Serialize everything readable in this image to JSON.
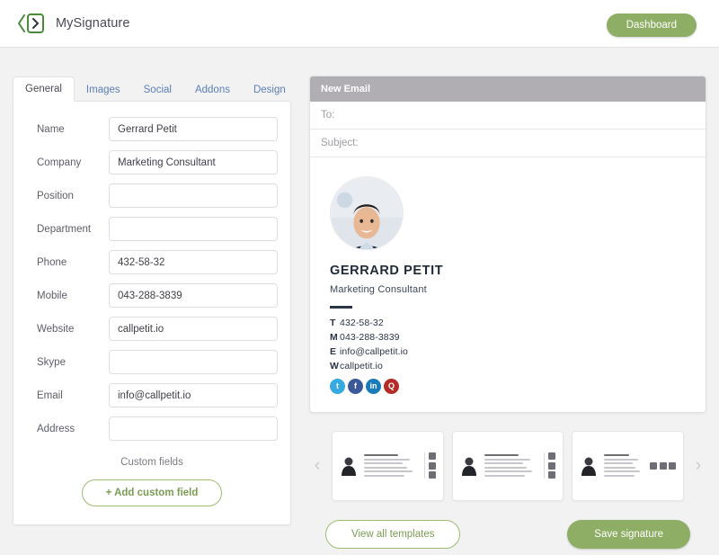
{
  "header": {
    "brand_name": "MySignature",
    "logo_icon": "code-brackets-logo-icon",
    "dashboard_label": "Dashboard"
  },
  "colors": {
    "brand_green": "#8fae65",
    "green_outline": "#9cbd71",
    "tab_link": "#5b7fb5",
    "email_header_bar": "#b0aeb3",
    "page_background": "#f2f2f3"
  },
  "tabs": [
    {
      "label": "General",
      "active": true
    },
    {
      "label": "Images",
      "active": false
    },
    {
      "label": "Social",
      "active": false
    },
    {
      "label": "Addons",
      "active": false
    },
    {
      "label": "Design",
      "active": false
    }
  ],
  "form": {
    "fields": [
      {
        "label": "Name",
        "value": "Gerrard Petit",
        "placeholder": ""
      },
      {
        "label": "Company",
        "value": "Marketing Consultant",
        "placeholder": ""
      },
      {
        "label": "Position",
        "value": "",
        "placeholder": ""
      },
      {
        "label": "Department",
        "value": "",
        "placeholder": ""
      },
      {
        "label": "Phone",
        "value": "432-58-32",
        "placeholder": ""
      },
      {
        "label": "Mobile",
        "value": "043-288-3839",
        "placeholder": ""
      },
      {
        "label": "Website",
        "value": "callpetit.io",
        "placeholder": ""
      },
      {
        "label": "Skype",
        "value": "",
        "placeholder": ""
      },
      {
        "label": "Email",
        "value": "info@callpetit.io",
        "placeholder": ""
      },
      {
        "label": "Address",
        "value": "",
        "placeholder": ""
      }
    ],
    "custom_fields_title": "Custom fields",
    "add_custom_field_label": "+ Add custom field"
  },
  "email_preview": {
    "header_label": "New Email",
    "to_label": "To:",
    "subject_label": "Subject:",
    "signature": {
      "avatar_icon": "user-photo-avatar",
      "name": "GERRARD PETIT",
      "role": "Marketing Consultant",
      "contacts": [
        {
          "prefix": "T",
          "value": "432-58-32"
        },
        {
          "prefix": "M",
          "value": "043-288-3839"
        },
        {
          "prefix": "E",
          "value": "info@callpetit.io"
        },
        {
          "prefix": "W",
          "value": "callpetit.io"
        }
      ],
      "socials": [
        {
          "name": "twitter-icon",
          "color": "#35a9e0",
          "glyph": "t"
        },
        {
          "name": "facebook-icon",
          "color": "#3b5998",
          "glyph": "f"
        },
        {
          "name": "linkedin-icon",
          "color": "#1b7bb9",
          "glyph": "in"
        },
        {
          "name": "quora-icon",
          "color": "#b52b27",
          "glyph": "Q"
        }
      ]
    }
  },
  "carousel": {
    "prev_icon": "chevron-left-icon",
    "next_icon": "chevron-right-icon",
    "prev_glyph": "‹",
    "next_glyph": "›",
    "templates": [
      {
        "name": "template-thumbnail-1"
      },
      {
        "name": "template-thumbnail-2"
      },
      {
        "name": "template-thumbnail-3"
      }
    ]
  },
  "footer": {
    "view_templates_label": "View all templates",
    "save_signature_label": "Save signature"
  }
}
